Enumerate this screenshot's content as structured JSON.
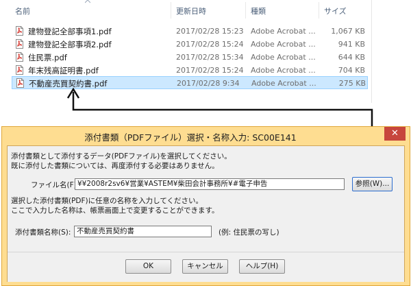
{
  "explorer": {
    "columns": {
      "name": "名前",
      "date": "更新日時",
      "type": "種類",
      "size": "サイズ"
    },
    "files": [
      {
        "name": "建物登記全部事項1.pdf",
        "date": "2017/02/28 15:23",
        "type": "Adobe Acrobat ...",
        "size": "1,067 KB",
        "selected": false
      },
      {
        "name": "建物登記全部事項2.pdf",
        "date": "2017/02/28 15:24",
        "type": "Adobe Acrobat ...",
        "size": "941 KB",
        "selected": false
      },
      {
        "name": "住民票.pdf",
        "date": "2017/02/28 15:34",
        "type": "Adobe Acrobat ...",
        "size": "644 KB",
        "selected": false
      },
      {
        "name": "年末残高証明書.pdf",
        "date": "2017/02/28 15:24",
        "type": "Adobe Acrobat ...",
        "size": "704 KB",
        "selected": false
      },
      {
        "name": "不動産売買契約書.pdf",
        "date": "2017/02/28 9:34",
        "type": "Adobe Acrobat ...",
        "size": "275 KB",
        "selected": true
      }
    ]
  },
  "dialog": {
    "title": "添付書類（PDFファイル）選択・名称入力: SC00E141",
    "close_glyph": "✕",
    "instruction1_line1": "添付書類として添付するデータ(PDFファイル)を選択してください。",
    "instruction1_line2": "既に添付した書類については、再度添付する必要はありません。",
    "file_label": "ファイル名(F):",
    "file_value": "¥¥2008r2sv6¥営業¥ASTEM¥柴田会計事務所¥#電子申告",
    "browse_label": "参照(W)...",
    "instruction2_line1": "選択した添付書類(PDF)に任意の名称を入力してください。",
    "instruction2_line2": "ここで入力した名称は、帳票画面上で変更することができます。",
    "name_label": "添付書類名称(S):",
    "name_value": "不動産売買契約書",
    "example_text": "(例: 住民票の写し)",
    "ok_label": "OK",
    "cancel_label": "キャンセル",
    "help_label": "ヘルプ(H)"
  },
  "colors": {
    "dialog_frame": "#fedd91",
    "close_button": "#c7463d",
    "selection": "#cce8ff",
    "pdf_icon": "#d22f27"
  }
}
